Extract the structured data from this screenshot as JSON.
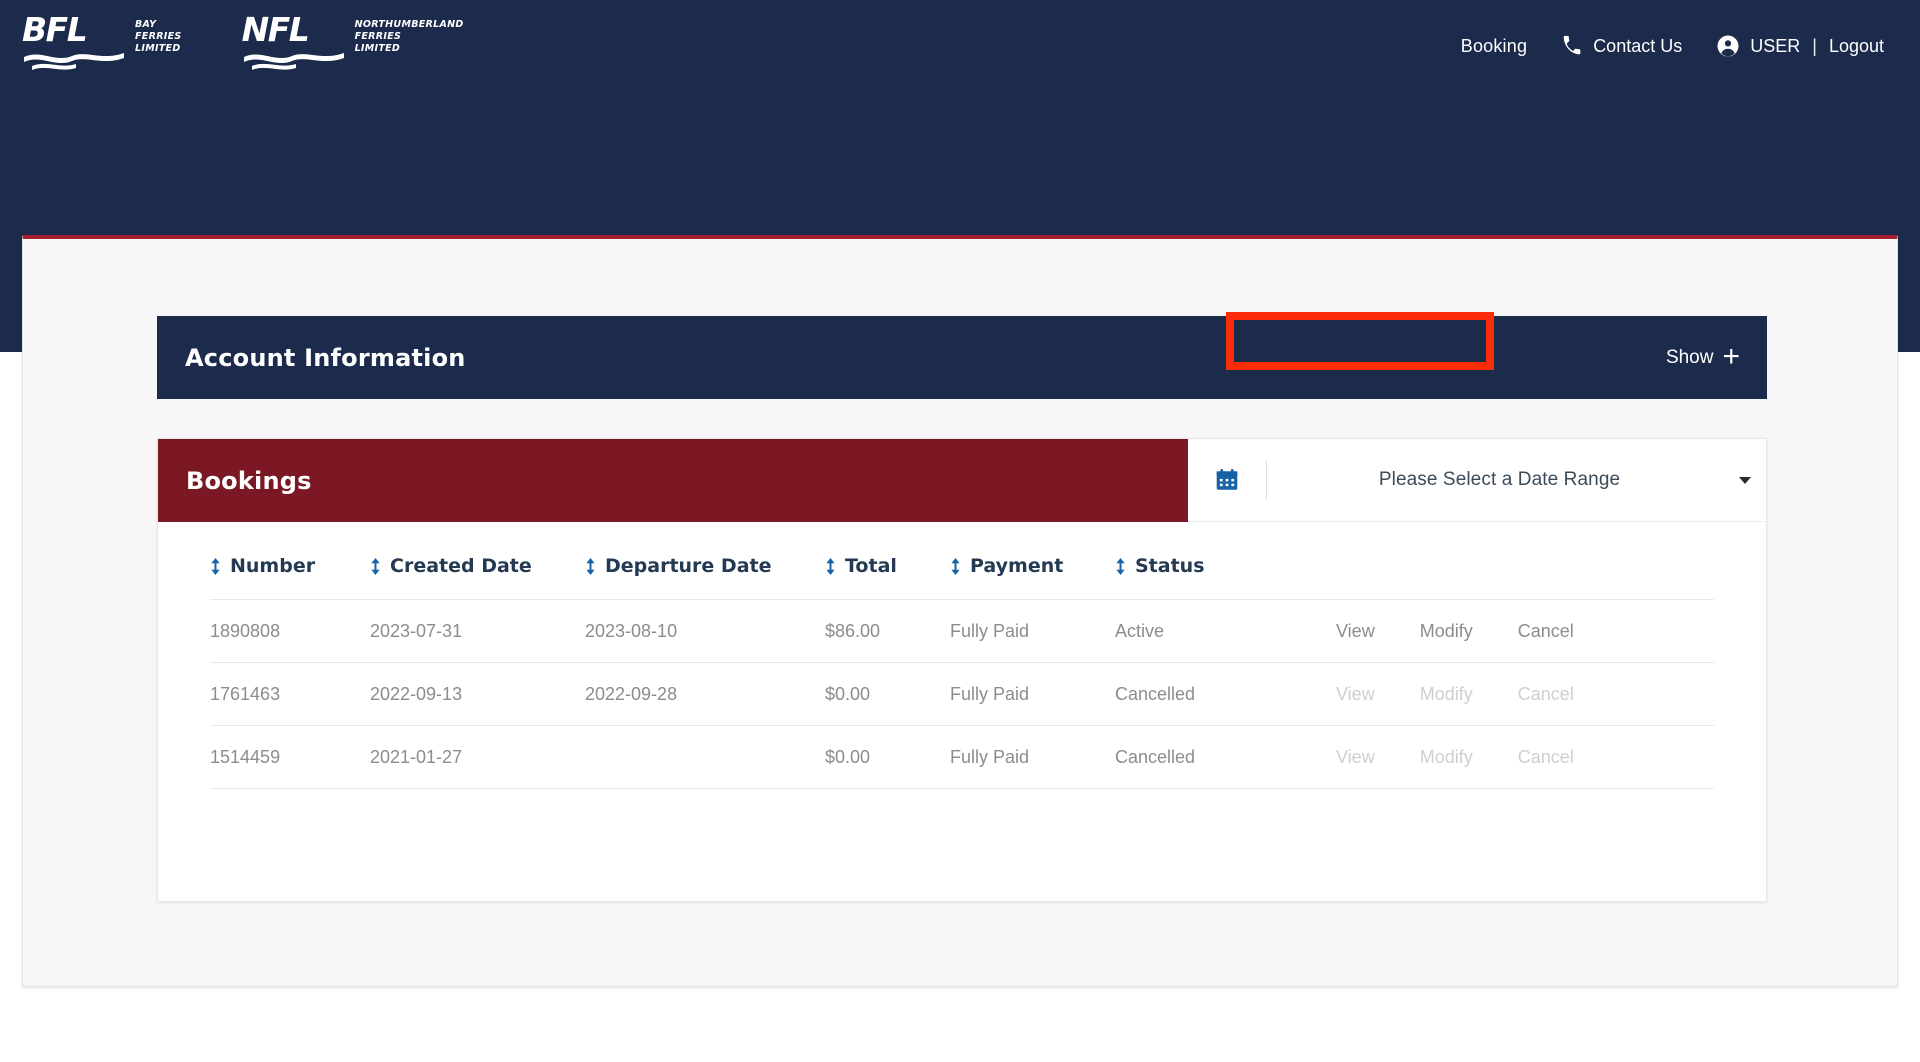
{
  "brand": {
    "logos": [
      {
        "abbr": "BFL",
        "words": "Bay\nFerries\nLimited",
        "line1": "BAY",
        "line2": "FERRIES",
        "line3": "LIMITED"
      },
      {
        "abbr": "NFL",
        "words": "Northumberland\nFerries\nLimited",
        "line1": "NORTHUMBERLAND",
        "line2": "FERRIES",
        "line3": "LIMITED"
      }
    ],
    "header_bg": "#1c2b4b",
    "accent_red": "#a62030",
    "bookings_red": "#7b1824",
    "annotation_red": "#fb2c08"
  },
  "topnav": {
    "booking": "Booking",
    "contact_us": "Contact Us",
    "user": "USER",
    "separator": "|",
    "logout": "Logout",
    "phone_icon": "phone-icon",
    "user_icon": "user-circle-icon"
  },
  "account_section": {
    "title": "Account Information",
    "show_label": "Show",
    "plus": "+"
  },
  "bookings_section": {
    "title": "Bookings",
    "date_range_placeholder": "Please Select a Date Range",
    "calendar_icon": "calendar-icon",
    "dropdown_icon": "chevron-down-icon",
    "table": {
      "headers": [
        "Number",
        "Created Date",
        "Departure Date",
        "Total",
        "Payment",
        "Status"
      ],
      "actions_header": "",
      "rows": [
        {
          "number": "1890808",
          "created_date": "2023-07-31",
          "departure_date": "2023-08-10",
          "total": "$86.00",
          "payment": "Fully Paid",
          "status": "Active",
          "view": "View",
          "modify": "Modify",
          "cancel": "Cancel",
          "actions_enabled": true
        },
        {
          "number": "1761463",
          "created_date": "2022-09-13",
          "departure_date": "2022-09-28",
          "total": "$0.00",
          "payment": "Fully Paid",
          "status": "Cancelled",
          "view": "View",
          "modify": "Modify",
          "cancel": "Cancel",
          "actions_enabled": false
        },
        {
          "number": "1514459",
          "created_date": "2021-01-27",
          "departure_date": "",
          "total": "$0.00",
          "payment": "Fully Paid",
          "status": "Cancelled",
          "view": "View",
          "modify": "Modify",
          "cancel": "Cancel",
          "actions_enabled": false
        }
      ]
    }
  }
}
